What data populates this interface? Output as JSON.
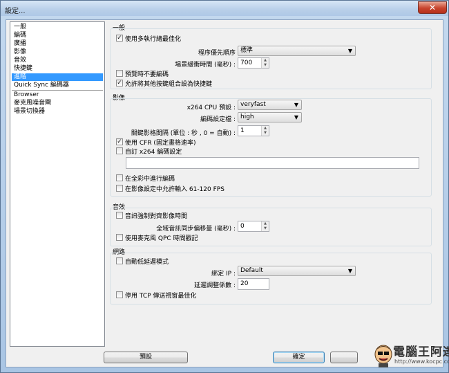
{
  "window": {
    "title": "設定...",
    "close_glyph": "✕"
  },
  "sidebar": {
    "items": [
      {
        "label": "一般"
      },
      {
        "label": "編碼"
      },
      {
        "label": "廣播"
      },
      {
        "label": "影像"
      },
      {
        "label": "音效"
      },
      {
        "label": "快捷鍵"
      },
      {
        "label": "進階",
        "selected": true
      },
      {
        "label": "Quick Sync 編碼器"
      }
    ],
    "plugins": [
      {
        "label": "Browser"
      },
      {
        "label": "麥克風噪音閘"
      },
      {
        "label": "場景切換器"
      }
    ]
  },
  "general": {
    "title": "一般",
    "multithread_opt": {
      "label": "使用多執行緒最佳化",
      "checked": true
    },
    "priority": {
      "label": "程序優先順序",
      "value": "標準"
    },
    "scene_buffer": {
      "label": "場景緩衝時間 (毫秒) :",
      "value": "700"
    },
    "disable_preview_encoding": {
      "label": "預覽時不要編碼",
      "checked": false
    },
    "allow_hotkey_combo": {
      "label": "允許將其他按鍵組合設為快捷鍵",
      "checked": true
    }
  },
  "video": {
    "title": "影像",
    "preset": {
      "label": "x264 CPU 預設 :",
      "value": "veryfast"
    },
    "encoding_profile": {
      "label": "編碼設定檔 :",
      "value": "high"
    },
    "keyframe_interval": {
      "label": "關鍵影格間隔 (單位 : 秒 , 0 = 自動) :",
      "value": "1"
    },
    "use_cfr": {
      "label": "使用 CFR (固定畫格速率)",
      "checked": true
    },
    "custom_x264": {
      "label": "自訂 x264 編碼設定",
      "checked": false,
      "value": ""
    },
    "full_range": {
      "label": "在全彩中進行編碼",
      "checked": false
    },
    "allow_61_120": {
      "label": "在影像設定中允許輸入 61-120 FPS",
      "checked": false
    }
  },
  "audio": {
    "title": "音效",
    "force_sync": {
      "label": "音訊強制對齊影像時間",
      "checked": false
    },
    "global_offset": {
      "label": "全域音訊同步偏移量 (毫秒) :",
      "value": "0"
    },
    "use_qpc": {
      "label": "使用麥克風 QPC 時間戳記",
      "checked": false
    }
  },
  "network": {
    "title": "網路",
    "low_latency": {
      "label": "自動低延遲模式",
      "checked": false
    },
    "bind_ip": {
      "label": "綁定 IP :",
      "value": "Default"
    },
    "latency_factor": {
      "label": "延遲調整係數 :",
      "value": "20"
    },
    "disable_tcp_window": {
      "label": "停用 TCP 傳送視窗最佳化",
      "checked": false
    }
  },
  "buttons": {
    "defaults": "預設",
    "ok": "確定"
  },
  "watermark": {
    "text": "電腦王阿達",
    "url": "http://www.kocpc.com.tw"
  },
  "glyphs": {
    "check": "✓",
    "arrow": "▼",
    "spin_up": "▲",
    "spin_down": "▼"
  }
}
